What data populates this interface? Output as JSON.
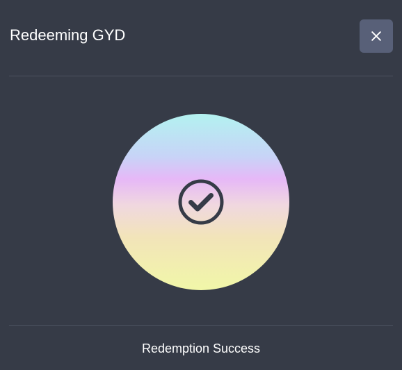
{
  "dialog": {
    "title": "Redeeming GYD",
    "close_icon": "close-icon",
    "status_icon": "check-circle-icon",
    "status_text": "Redemption Success"
  },
  "colors": {
    "background": "#363b47",
    "close_button": "#586078",
    "divider": "#4c5260",
    "icon": "#363b47",
    "gradient": [
      "#b3f2f0",
      "#c7d4f7",
      "#e6b8f7",
      "#f0d8df",
      "#f2e4b9",
      "#f1f7a8"
    ]
  }
}
